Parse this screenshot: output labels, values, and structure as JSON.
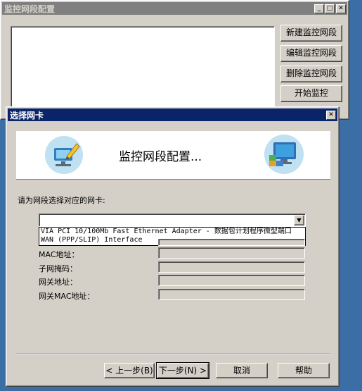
{
  "main_window": {
    "title": "监控网段配置",
    "buttons": {
      "new": "新建监控网段",
      "edit": "编辑监控网段",
      "delete": "删除监控网段",
      "start": "开始监控"
    }
  },
  "dialog": {
    "title": "选择网卡",
    "banner_title": "监控网段配置...",
    "prompt": "请为网段选择对应的网卡:",
    "dropdown": {
      "selected": "",
      "options": [
        "VIA PCI 10/100Mb Fast Ethernet Adapter - 数据包计划程序微型端口",
        "WAN (PPP/SLIP) Interface"
      ]
    },
    "fields": {
      "mac_label": "MAC地址：",
      "subnet_label": "子网掩码：",
      "gateway_label": "网关地址：",
      "gateway_mac_label": "网关MAC地址："
    },
    "buttons": {
      "prev": "< 上一步(B)",
      "next": "下一步(N) >",
      "cancel": "取消",
      "help": "帮助"
    }
  },
  "colors": {
    "desktop": "#3a6ea5",
    "active_title": "#0a246a",
    "inactive_title": "#808080",
    "face": "#d4d0c8"
  }
}
